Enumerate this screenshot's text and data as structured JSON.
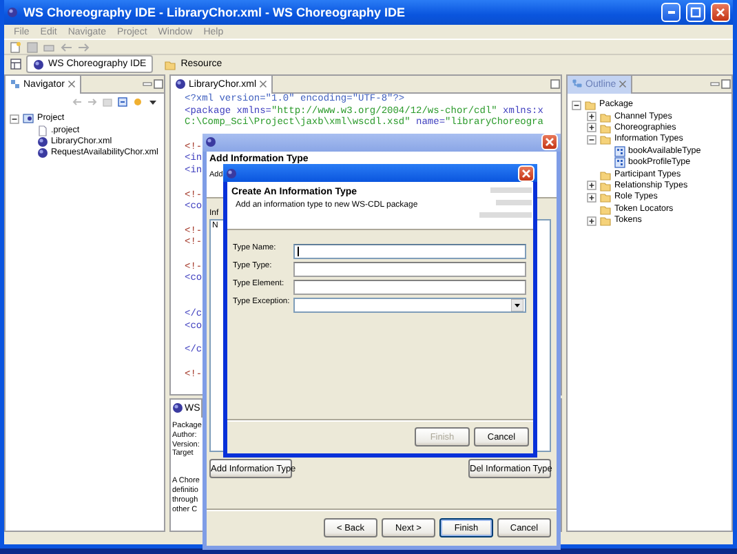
{
  "window": {
    "title": "WS Choreography IDE - LibraryChor.xml - WS Choreography IDE"
  },
  "menu": [
    "File",
    "Edit",
    "Navigate",
    "Project",
    "Window",
    "Help"
  ],
  "perspectives": [
    {
      "label": "WS Choreography IDE",
      "selected": true
    },
    {
      "label": "Resource",
      "selected": false
    }
  ],
  "navigator": {
    "title": "Navigator",
    "tree": [
      {
        "label": "Project",
        "kind": "project",
        "expanded": true,
        "children": [
          {
            "label": ".project",
            "kind": "file"
          },
          {
            "label": "LibraryChor.xml",
            "kind": "choreography"
          },
          {
            "label": "RequestAvailabilityChor.xml",
            "kind": "choreography"
          }
        ]
      }
    ]
  },
  "editor": {
    "tab": "LibraryChor.xml",
    "lines": [
      {
        "kind": "code",
        "segments": [
          {
            "kind": "pi",
            "text": "<?xml version=\"1.0\" encoding=\"UTF-8\"?>"
          }
        ]
      },
      {
        "kind": "code",
        "segments": [
          {
            "kind": "tag",
            "text": "<package xmlns="
          },
          {
            "kind": "string",
            "text": "\"http://www.w3.org/2004/12/ws-chor/cdl\""
          },
          {
            "kind": "tag",
            "text": " xmlns:x"
          }
        ]
      },
      {
        "kind": "code",
        "segments": [
          {
            "kind": "string",
            "text": "C:\\Comp_Sci\\Project\\jaxb\\xml\\wscdl.xsd\""
          },
          {
            "kind": "tag",
            "text": " name="
          },
          {
            "kind": "string",
            "text": "\"libraryChoreogra"
          }
        ]
      },
      {
        "kind": "blank"
      },
      {
        "kind": "code",
        "segments": [
          {
            "kind": "comment",
            "text": "<!-"
          }
        ]
      },
      {
        "kind": "code",
        "segments": [
          {
            "kind": "tag",
            "text": "<in"
          }
        ]
      },
      {
        "kind": "code",
        "segments": [
          {
            "kind": "tag",
            "text": "<in"
          }
        ]
      },
      {
        "kind": "blank"
      },
      {
        "kind": "code",
        "segments": [
          {
            "kind": "comment",
            "text": "<!-"
          }
        ]
      },
      {
        "kind": "code",
        "segments": [
          {
            "kind": "tag",
            "text": "<co"
          }
        ]
      },
      {
        "kind": "blank"
      },
      {
        "kind": "code",
        "segments": [
          {
            "kind": "comment",
            "text": "<!-"
          }
        ]
      },
      {
        "kind": "code",
        "segments": [
          {
            "kind": "comment",
            "text": "<!-"
          }
        ]
      },
      {
        "kind": "blank"
      },
      {
        "kind": "code",
        "segments": [
          {
            "kind": "comment",
            "text": "<!-"
          }
        ]
      },
      {
        "kind": "code",
        "segments": [
          {
            "kind": "tag",
            "text": "<co"
          }
        ]
      },
      {
        "kind": "blank"
      },
      {
        "kind": "blank"
      },
      {
        "kind": "code",
        "segments": [
          {
            "kind": "tag",
            "text": "</c"
          }
        ]
      },
      {
        "kind": "code",
        "segments": [
          {
            "kind": "tag",
            "text": "<co"
          }
        ]
      },
      {
        "kind": "blank"
      },
      {
        "kind": "code",
        "segments": [
          {
            "kind": "tag",
            "text": "</c"
          }
        ]
      },
      {
        "kind": "blank"
      },
      {
        "kind": "code",
        "segments": [
          {
            "kind": "comment",
            "text": "<!-"
          }
        ]
      }
    ],
    "info": {
      "tab": "WS",
      "lines": [
        "Package",
        "Author:",
        "Version:",
        "Target"
      ],
      "description": [
        "A Chore",
        "definitio",
        "through",
        "other C"
      ]
    }
  },
  "outline": {
    "title": "Outline",
    "tree": [
      {
        "label": "Package",
        "kind": "folder",
        "expanded": true,
        "children": [
          {
            "label": "Channel Types",
            "kind": "folder",
            "expanded": false
          },
          {
            "label": "Choreographies",
            "kind": "folder",
            "expanded": false
          },
          {
            "label": "Information Types",
            "kind": "folder",
            "expanded": true,
            "children": [
              {
                "label": "bookAvailableType",
                "kind": "type"
              },
              {
                "label": "bookProfileType",
                "kind": "type"
              }
            ]
          },
          {
            "label": "Participant Types",
            "kind": "folder"
          },
          {
            "label": "Relationship Types",
            "kind": "folder",
            "expanded": false
          },
          {
            "label": "Role Types",
            "kind": "folder",
            "expanded": false
          },
          {
            "label": "Token Locators",
            "kind": "folder"
          },
          {
            "label": "Tokens",
            "kind": "folder",
            "expanded": false
          }
        ]
      }
    ]
  },
  "wizard": {
    "heading": "Add Information Type",
    "subtitle": "Add",
    "list_label": "Inf",
    "list_items": [
      "N"
    ],
    "buttons": [
      "Add Information Type",
      "Del Information Type"
    ],
    "nav_buttons": [
      {
        "label": "< Back",
        "disabled": false,
        "default": false
      },
      {
        "label": "Next >",
        "disabled": false,
        "default": false
      },
      {
        "label": "Finish",
        "disabled": false,
        "default": true
      },
      {
        "label": "Cancel",
        "disabled": false,
        "default": false
      }
    ]
  },
  "dialog": {
    "title": "Create An Information Type",
    "description": "Add an information type to new WS-CDL package",
    "fields": [
      {
        "label": "Type Name:",
        "kind": "text",
        "focused": true
      },
      {
        "label": "Type Type:",
        "kind": "text",
        "focused": false
      },
      {
        "label": "Type Element:",
        "kind": "text",
        "focused": false
      },
      {
        "label": "Type Exception:",
        "kind": "combo",
        "focused": false
      }
    ],
    "buttons": [
      {
        "label": "Finish",
        "disabled": true
      },
      {
        "label": "Cancel",
        "disabled": false
      }
    ]
  }
}
